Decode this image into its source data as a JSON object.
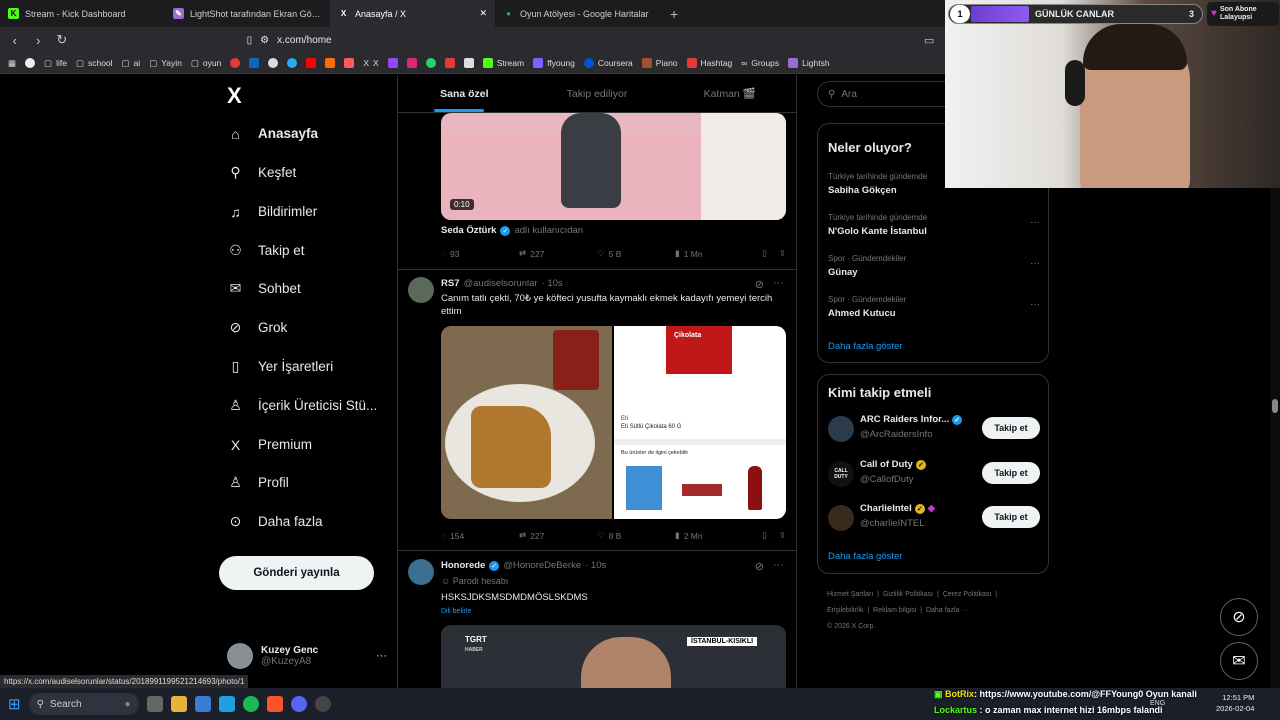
{
  "browser": {
    "tabs": [
      {
        "title": "Stream - Kick Dashboard",
        "color": "#53fc18",
        "glyph": "K"
      },
      {
        "title": "LightShot tarafından Ekran Görüntüsü",
        "color": "#9b6bd6",
        "glyph": "✎"
      },
      {
        "title": "Anasayfa / X",
        "color": "#000000",
        "glyph": "X"
      },
      {
        "title": "Oyun Atölyesi - Google Haritalar",
        "color": "#34a853",
        "glyph": "●"
      }
    ],
    "url": "x.com/home",
    "bookmarks": [
      "life",
      "school",
      "ai",
      "Yayin",
      "oyun",
      "X",
      "Stream",
      "ffyoung",
      "Coursera",
      "Piano",
      "Hashtag",
      "Groups",
      "Lightsh"
    ],
    "status_url": "https://x.com/audiselsorunlar/status/2018991199521214693/photo/1"
  },
  "nav": {
    "items": [
      "Anasayfa",
      "Keşfet",
      "Bildirimler",
      "Takip et",
      "Sohbet",
      "Grok",
      "Yer İşaretleri",
      "İçerik Üreticisi Stü...",
      "Premium",
      "Profil",
      "Daha fazla"
    ],
    "post_button": "Gönderi yayınla",
    "account_name": "Kuzey Genc",
    "account_handle": "@KuzeyA8"
  },
  "timeline": {
    "tabs": [
      "Sana özel",
      "Takip ediliyor",
      "Katman 🎬"
    ],
    "post1": {
      "video_time": "0:10",
      "credit_name": "Seda Öztürk",
      "credit_suffix": "adlı kullanıcıdan",
      "replies": "93",
      "reposts": "227",
      "likes": "5 B",
      "views": "1 Mn"
    },
    "post2": {
      "name": "RS7",
      "handle": "@audiselsorunlar",
      "time": "· 10s",
      "text": "Canım tatlı çekti, 70₺ ye köfteci yusufta kaymaklı ekmek kadayıfı yemeyi tercih ettim",
      "product_name": "Eti Sütlü Çikolata 60 G",
      "product_brand": "Eti",
      "product_pack_label": "Çikolata",
      "related_label": "Bu ürünler de ilgini çekebilir",
      "replies": "154",
      "reposts": "227",
      "likes": "8 B",
      "views": "2 Mn"
    },
    "post3": {
      "name": "Honorede",
      "handle": "@HonoreDeBerke",
      "time": "· 10s",
      "label": "Parodi hesabı",
      "text": "HSKSJDKSMSDMDMÖSLSKDMS",
      "translate": "Dili belirle",
      "tv_logo": "TGRT",
      "tv_sub": "HABER",
      "tv_banner": "İSTANBUL-KISIKLI"
    }
  },
  "sidebar": {
    "search_placeholder": "Ara",
    "trends_title": "Neler oluyor?",
    "trends": [
      {
        "category": "Türkiye tarihinde gündemde",
        "name": "Sabiha Gökçen"
      },
      {
        "category": "Türkiye tarihinde gündemde",
        "name": "N'Golo Kante İstanbul"
      },
      {
        "category": "Spor · Gündemdekiler",
        "name": "Günay"
      },
      {
        "category": "Spor · Gündemdekiler",
        "name": "Ahmed Kutucu"
      }
    ],
    "show_more": "Daha fazla göster",
    "who_title": "Kimi takip etmeli",
    "who": [
      {
        "name": "ARC Raiders Infor...",
        "handle": "@ArcRaidersInfo",
        "color": "#2a3b4c"
      },
      {
        "name": "Call of Duty",
        "handle": "@CallofDuty",
        "color": "#111111"
      },
      {
        "name": "CharlieIntel",
        "handle": "@charlieINTEL",
        "color": "#3a2a1c"
      }
    ],
    "who_avatar_text": "CALL DUTY",
    "follow_label": "Takip et",
    "footer": [
      "Hizmet Şartları",
      "Gizlilik Politikası",
      "Çerez Politikası",
      "Erişilebilirlik",
      "Reklam bilgisi",
      "Daha fazla ···",
      "© 2026 X Corp."
    ]
  },
  "overlay": {
    "goal_level": "1",
    "goal_label": "GÜNLÜK CANLAR",
    "goal_count": "3",
    "goal_progress": 0.25,
    "sub_label_1": "Son Abone",
    "sub_label_2": "Lalayupsi",
    "chat": [
      {
        "user": "BotRix",
        "text": "https://www.youtube.com/@FFYoung0 Oyun kanali",
        "color": "#f3e600"
      },
      {
        "user": "Lockartus",
        "text": "o zaman max internet hizi 16mbps falandi",
        "color": "#53fc18"
      }
    ]
  },
  "taskbar": {
    "search": "Search",
    "lang": "ENG",
    "time": "12:51 PM",
    "date": "2026-02-04"
  }
}
